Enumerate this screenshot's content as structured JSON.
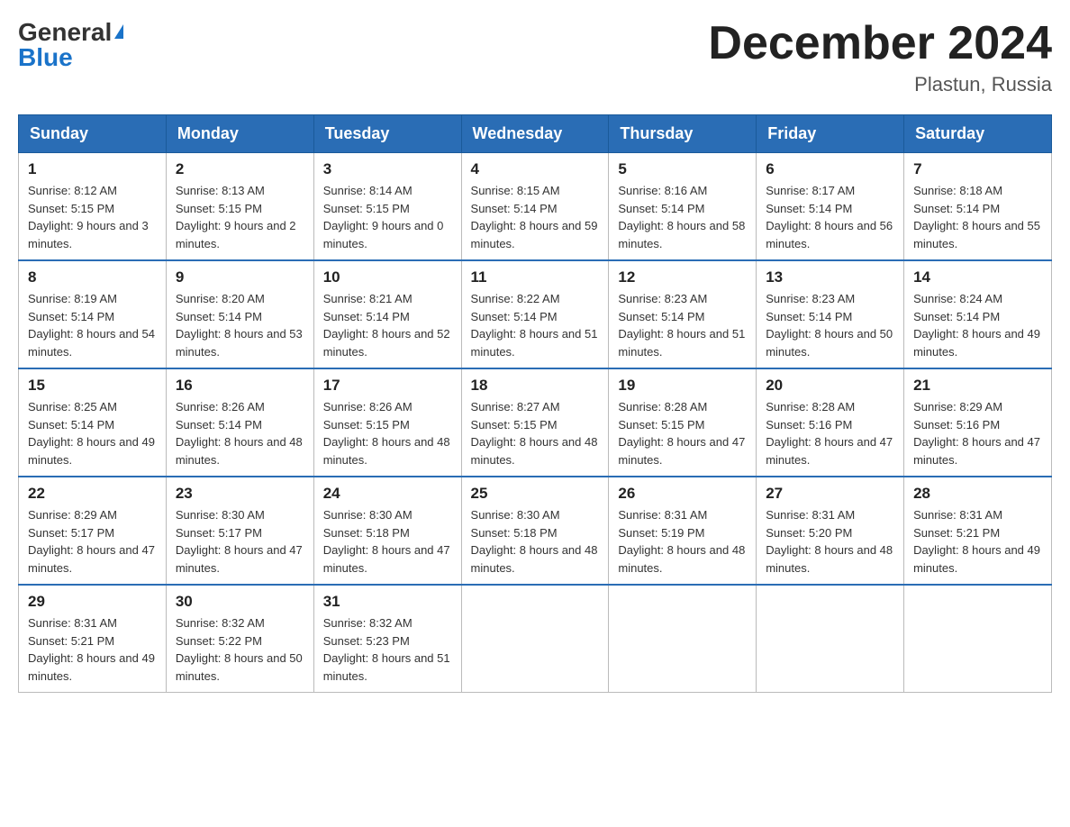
{
  "logo": {
    "general": "General",
    "blue": "Blue"
  },
  "title": {
    "month_year": "December 2024",
    "location": "Plastun, Russia"
  },
  "weekdays": [
    "Sunday",
    "Monday",
    "Tuesday",
    "Wednesday",
    "Thursday",
    "Friday",
    "Saturday"
  ],
  "weeks": [
    [
      {
        "day": "1",
        "sunrise": "8:12 AM",
        "sunset": "5:15 PM",
        "daylight": "9 hours and 3 minutes."
      },
      {
        "day": "2",
        "sunrise": "8:13 AM",
        "sunset": "5:15 PM",
        "daylight": "9 hours and 2 minutes."
      },
      {
        "day": "3",
        "sunrise": "8:14 AM",
        "sunset": "5:15 PM",
        "daylight": "9 hours and 0 minutes."
      },
      {
        "day": "4",
        "sunrise": "8:15 AM",
        "sunset": "5:14 PM",
        "daylight": "8 hours and 59 minutes."
      },
      {
        "day": "5",
        "sunrise": "8:16 AM",
        "sunset": "5:14 PM",
        "daylight": "8 hours and 58 minutes."
      },
      {
        "day": "6",
        "sunrise": "8:17 AM",
        "sunset": "5:14 PM",
        "daylight": "8 hours and 56 minutes."
      },
      {
        "day": "7",
        "sunrise": "8:18 AM",
        "sunset": "5:14 PM",
        "daylight": "8 hours and 55 minutes."
      }
    ],
    [
      {
        "day": "8",
        "sunrise": "8:19 AM",
        "sunset": "5:14 PM",
        "daylight": "8 hours and 54 minutes."
      },
      {
        "day": "9",
        "sunrise": "8:20 AM",
        "sunset": "5:14 PM",
        "daylight": "8 hours and 53 minutes."
      },
      {
        "day": "10",
        "sunrise": "8:21 AM",
        "sunset": "5:14 PM",
        "daylight": "8 hours and 52 minutes."
      },
      {
        "day": "11",
        "sunrise": "8:22 AM",
        "sunset": "5:14 PM",
        "daylight": "8 hours and 51 minutes."
      },
      {
        "day": "12",
        "sunrise": "8:23 AM",
        "sunset": "5:14 PM",
        "daylight": "8 hours and 51 minutes."
      },
      {
        "day": "13",
        "sunrise": "8:23 AM",
        "sunset": "5:14 PM",
        "daylight": "8 hours and 50 minutes."
      },
      {
        "day": "14",
        "sunrise": "8:24 AM",
        "sunset": "5:14 PM",
        "daylight": "8 hours and 49 minutes."
      }
    ],
    [
      {
        "day": "15",
        "sunrise": "8:25 AM",
        "sunset": "5:14 PM",
        "daylight": "8 hours and 49 minutes."
      },
      {
        "day": "16",
        "sunrise": "8:26 AM",
        "sunset": "5:14 PM",
        "daylight": "8 hours and 48 minutes."
      },
      {
        "day": "17",
        "sunrise": "8:26 AM",
        "sunset": "5:15 PM",
        "daylight": "8 hours and 48 minutes."
      },
      {
        "day": "18",
        "sunrise": "8:27 AM",
        "sunset": "5:15 PM",
        "daylight": "8 hours and 48 minutes."
      },
      {
        "day": "19",
        "sunrise": "8:28 AM",
        "sunset": "5:15 PM",
        "daylight": "8 hours and 47 minutes."
      },
      {
        "day": "20",
        "sunrise": "8:28 AM",
        "sunset": "5:16 PM",
        "daylight": "8 hours and 47 minutes."
      },
      {
        "day": "21",
        "sunrise": "8:29 AM",
        "sunset": "5:16 PM",
        "daylight": "8 hours and 47 minutes."
      }
    ],
    [
      {
        "day": "22",
        "sunrise": "8:29 AM",
        "sunset": "5:17 PM",
        "daylight": "8 hours and 47 minutes."
      },
      {
        "day": "23",
        "sunrise": "8:30 AM",
        "sunset": "5:17 PM",
        "daylight": "8 hours and 47 minutes."
      },
      {
        "day": "24",
        "sunrise": "8:30 AM",
        "sunset": "5:18 PM",
        "daylight": "8 hours and 47 minutes."
      },
      {
        "day": "25",
        "sunrise": "8:30 AM",
        "sunset": "5:18 PM",
        "daylight": "8 hours and 48 minutes."
      },
      {
        "day": "26",
        "sunrise": "8:31 AM",
        "sunset": "5:19 PM",
        "daylight": "8 hours and 48 minutes."
      },
      {
        "day": "27",
        "sunrise": "8:31 AM",
        "sunset": "5:20 PM",
        "daylight": "8 hours and 48 minutes."
      },
      {
        "day": "28",
        "sunrise": "8:31 AM",
        "sunset": "5:21 PM",
        "daylight": "8 hours and 49 minutes."
      }
    ],
    [
      {
        "day": "29",
        "sunrise": "8:31 AM",
        "sunset": "5:21 PM",
        "daylight": "8 hours and 49 minutes."
      },
      {
        "day": "30",
        "sunrise": "8:32 AM",
        "sunset": "5:22 PM",
        "daylight": "8 hours and 50 minutes."
      },
      {
        "day": "31",
        "sunrise": "8:32 AM",
        "sunset": "5:23 PM",
        "daylight": "8 hours and 51 minutes."
      },
      null,
      null,
      null,
      null
    ]
  ]
}
